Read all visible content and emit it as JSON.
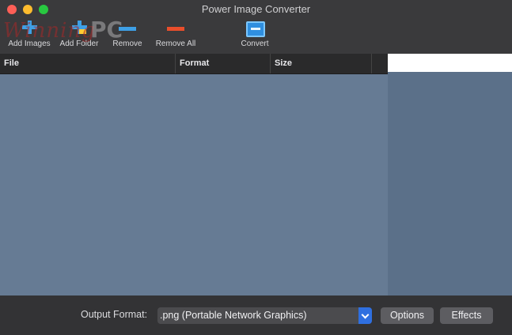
{
  "window": {
    "title": "Power Image Converter"
  },
  "watermark": {
    "script": "Winning",
    "pc": "PC"
  },
  "toolbar": {
    "add_images": "Add Images",
    "add_folder": "Add Folder",
    "remove": "Remove",
    "remove_all": "Remove All",
    "convert": "Convert"
  },
  "table": {
    "columns": [
      "File",
      "Format",
      "Size"
    ]
  },
  "footer": {
    "output_format_label": "Output Format:",
    "output_format_value": ".png (Portable Network Graphics)",
    "options_button": "Options",
    "effects_button": "Effects"
  },
  "colors": {
    "accent": "#2f6fe0",
    "list_bg": "#667b94",
    "panel_bg": "#5b7089"
  }
}
